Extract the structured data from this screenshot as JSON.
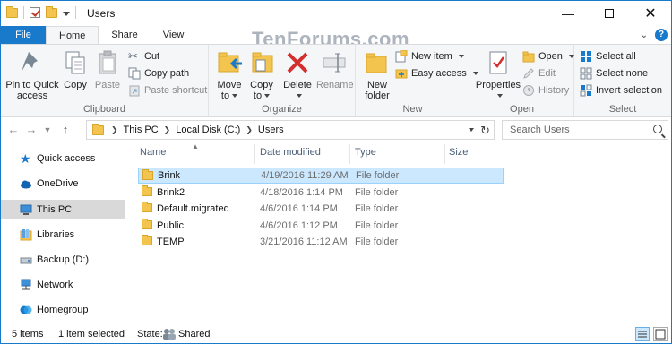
{
  "window": {
    "title": "Users"
  },
  "watermark": "TenForums.com",
  "tabs": [
    {
      "label": "File"
    },
    {
      "label": "Home"
    },
    {
      "label": "Share"
    },
    {
      "label": "View"
    }
  ],
  "ribbon": {
    "clipboard": {
      "label": "Clipboard",
      "pin": "Pin to Quick",
      "pin2": "access",
      "copy": "Copy",
      "paste": "Paste",
      "cut": "Cut",
      "copy_path": "Copy path",
      "paste_shortcut": "Paste shortcut"
    },
    "organize": {
      "label": "Organize",
      "move_to": "Move",
      "move_to2": "to",
      "copy_to": "Copy",
      "copy_to2": "to",
      "delete": "Delete",
      "rename": "Rename"
    },
    "new": {
      "label": "New",
      "new_folder": "New",
      "new_folder2": "folder",
      "new_item": "New item",
      "easy_access": "Easy access"
    },
    "open": {
      "label": "Open",
      "properties": "Properties",
      "open": "Open",
      "edit": "Edit",
      "history": "History"
    },
    "select": {
      "label": "Select",
      "select_all": "Select all",
      "select_none": "Select none",
      "invert": "Invert selection"
    }
  },
  "address": {
    "crumbs": [
      "This PC",
      "Local Disk (C:)",
      "Users"
    ],
    "search_placeholder": "Search Users"
  },
  "nav_pane": [
    {
      "label": "Quick access",
      "icon": "star-icon"
    },
    {
      "label": "OneDrive",
      "icon": "cloud-icon"
    },
    {
      "label": "This PC",
      "icon": "computer-icon"
    },
    {
      "label": "Libraries",
      "icon": "library-icon"
    },
    {
      "label": "Backup (D:)",
      "icon": "drive-icon"
    },
    {
      "label": "Network",
      "icon": "network-icon"
    },
    {
      "label": "Homegroup",
      "icon": "homegroup-icon"
    }
  ],
  "columns": {
    "name": "Name",
    "date": "Date modified",
    "type": "Type",
    "size": "Size"
  },
  "files": [
    {
      "name": "Brink",
      "date": "4/19/2016 11:29 AM",
      "type": "File folder"
    },
    {
      "name": "Brink2",
      "date": "4/18/2016 1:14 PM",
      "type": "File folder"
    },
    {
      "name": "Default.migrated",
      "date": "4/6/2016 1:14 PM",
      "type": "File folder"
    },
    {
      "name": "Public",
      "date": "4/6/2016 1:12 PM",
      "type": "File folder"
    },
    {
      "name": "TEMP",
      "date": "3/21/2016 11:12 AM",
      "type": "File folder"
    }
  ],
  "status": {
    "items": "5 items",
    "selected": "1 item selected",
    "state_label": "State:",
    "state_value": "Shared"
  },
  "colors": {
    "accent": "#1979ca",
    "selection": "#cce8ff",
    "folder": "#f3c54f"
  }
}
